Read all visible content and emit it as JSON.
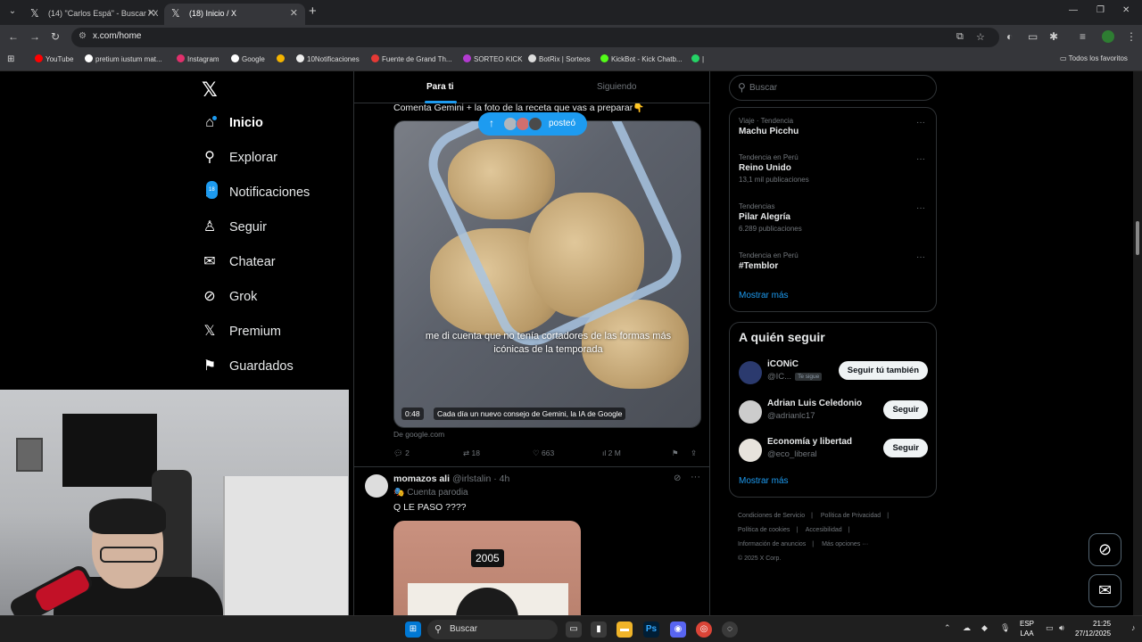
{
  "browser": {
    "tabs": [
      {
        "title": "(14) \"Carlos Espá\" - Buscar / X",
        "active": false
      },
      {
        "title": "(18) Inicio / X",
        "active": true
      }
    ],
    "url": "x.com/home",
    "bookmarks": [
      "YouTube",
      "pretium iustum mat...",
      "Instagram",
      "Google",
      "10Notificaciones",
      "Fuente de Grand Th...",
      "SORTEO KICK",
      "BotRix | Sorteos",
      "KickBot - Kick Chatb..."
    ],
    "all_bookmarks": "Todos los favoritos"
  },
  "sidebar": {
    "nav": [
      {
        "label": "Inicio",
        "icon": "home-icon"
      },
      {
        "label": "Explorar",
        "icon": "search-icon"
      },
      {
        "label": "Notificaciones",
        "icon": "bell-icon",
        "badge": "18"
      },
      {
        "label": "Seguir",
        "icon": "person-add-icon"
      },
      {
        "label": "Chatear",
        "icon": "mail-icon"
      },
      {
        "label": "Grok",
        "icon": "grok-icon"
      },
      {
        "label": "Premium",
        "icon": "x-logo-icon"
      },
      {
        "label": "Guardados",
        "icon": "bookmark-icon"
      }
    ]
  },
  "timeline": {
    "tabs": [
      "Para ti",
      "Siguiendo"
    ],
    "posted_pill": "posteó",
    "tweet1": {
      "text": "Comenta Gemini + la foto de la receta que vas a preparar👇",
      "caption": "me di cuenta que no tenía cortadores de las formas más icónicas de la temporada",
      "duration": "0:48",
      "video_label": "Cada día un nuevo consejo de Gemini, la IA de Google",
      "source": "De google.com",
      "replies": "2",
      "reposts": "18",
      "likes": "663",
      "views": "2 M"
    },
    "tweet2": {
      "name": "momazos ali",
      "handle": "@irlstalin · 4h",
      "sub": "🎭 Cuenta parodia",
      "text": "Q LE PASO ????",
      "image_tag": "2005"
    }
  },
  "right": {
    "search_placeholder": "Buscar",
    "trends": [
      {
        "context": "Viaje · Tendencia",
        "title": "Machu Picchu",
        "count": ""
      },
      {
        "context": "Tendencia en Perú",
        "title": "Reino Unido",
        "count": "13,1 mil publicaciones"
      },
      {
        "context": "Tendencias",
        "title": "Pilar Alegría",
        "count": "6.289 publicaciones"
      },
      {
        "context": "Tendencia en Perú",
        "title": "#Temblor",
        "count": ""
      }
    ],
    "show_more": "Mostrar más",
    "who_to_follow_title": "A quién seguir",
    "follow": [
      {
        "name": "iCONiC",
        "handle": "@IC...",
        "follows_you": "Te sigue",
        "button": "Seguir tú también"
      },
      {
        "name": "Adrian Luis Celedonio",
        "handle": "@adrianlc17",
        "button": "Seguir"
      },
      {
        "name": "Economía y libertad",
        "handle": "@eco_liberal",
        "button": "Seguir"
      }
    ],
    "footer": [
      "Condiciones de Servicio",
      "Política de Privacidad",
      "Política de cookies",
      "Accesibilidad",
      "Información de anuncios",
      "Más opciones ···",
      "© 2025 X Corp."
    ]
  },
  "taskbar": {
    "search": "Buscar",
    "lang_top": "ESP",
    "lang_bottom": "LAA",
    "time": "21:25",
    "date": "27/12/2025"
  },
  "colors": {
    "accent": "#1d9bf0",
    "background": "#000000",
    "border": "#2f3336"
  }
}
